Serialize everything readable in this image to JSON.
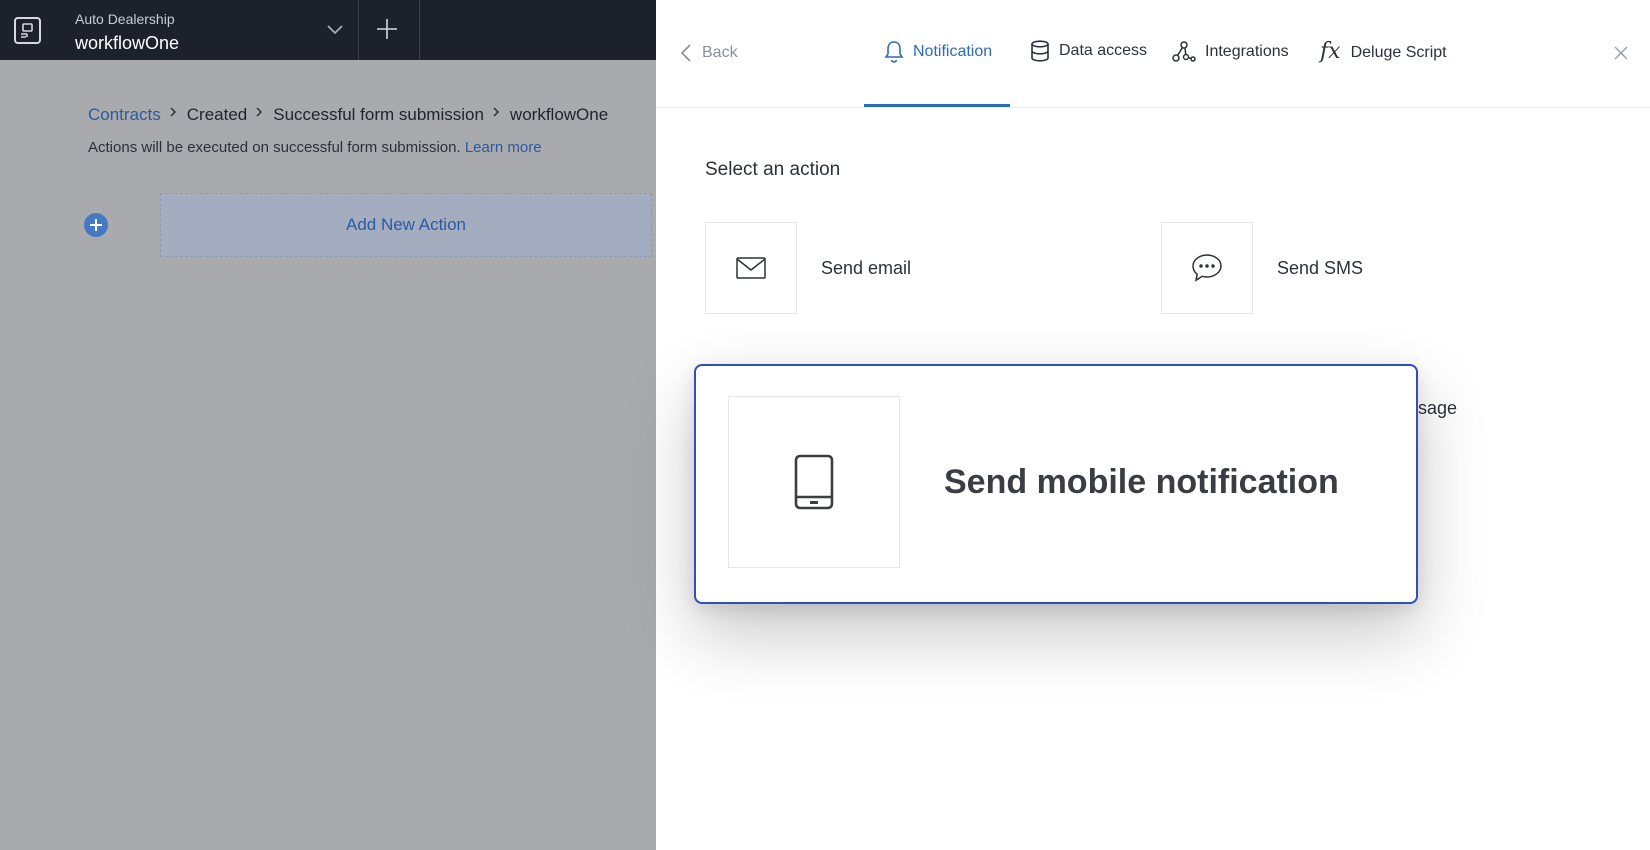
{
  "app": {
    "workspace": "Auto Dealership",
    "name": "workflowOne"
  },
  "breadcrumb": {
    "items": [
      "Contracts",
      "Created",
      "Successful form submission",
      "workflowOne"
    ]
  },
  "info": {
    "text": "Actions will be executed on successful form submission.",
    "link": "Learn more"
  },
  "add_action": {
    "label": "Add New Action"
  },
  "panel": {
    "back_label": "Back",
    "tabs": [
      {
        "label": "Notification",
        "icon": "bell-icon",
        "active": true
      },
      {
        "label": "Data access",
        "icon": "database-icon",
        "active": false
      },
      {
        "label": "Integrations",
        "icon": "integrations-icon",
        "active": false
      },
      {
        "label": "Deluge Script",
        "icon": "fx-icon",
        "active": false
      }
    ],
    "section_title": "Select an action",
    "actions": [
      {
        "label": "Send email",
        "icon": "envelope-icon"
      },
      {
        "label": "Send SMS",
        "icon": "chat-bubble-icon"
      }
    ],
    "partial_label": "ssage",
    "highlight": {
      "label": "Send mobile notification",
      "icon": "mobile-device-icon"
    }
  },
  "colors": {
    "accent": "#2b6cb8",
    "link": "#2b5aa3",
    "topbar": "#1c212b",
    "highlight_border": "#2f4fbf"
  }
}
